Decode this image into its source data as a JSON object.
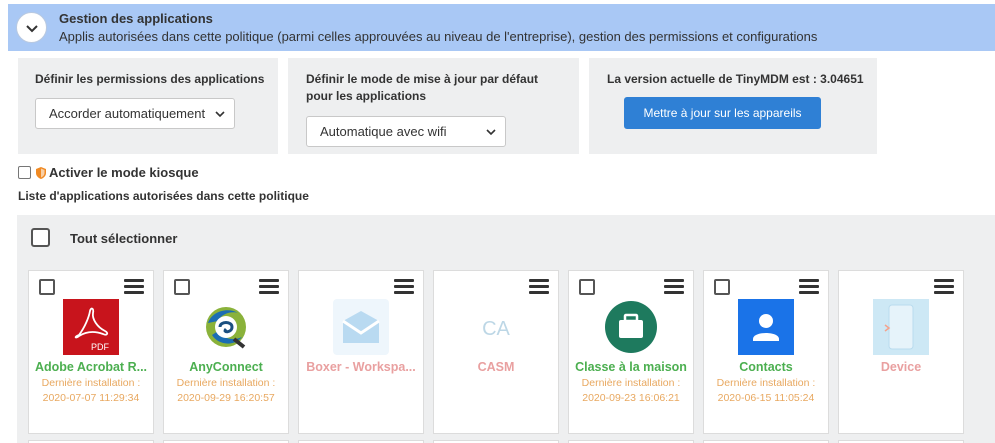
{
  "header": {
    "title": "Gestion des applications",
    "subtitle": "Applis autorisées dans cette politique (parmi celles approuvées au niveau de l'entreprise), gestion des permissions et configurations",
    "toggle_icon": "chevron-down-icon"
  },
  "permissions": {
    "label": "Définir les permissions des applications",
    "selected": "Accorder automatiquement"
  },
  "update_mode": {
    "label_line1": "Définir le mode de mise à jour par défaut",
    "label_line2": "pour les applications",
    "selected": "Automatique avec wifi"
  },
  "version": {
    "label": "La version actuelle de TinyMDM est : 3.04651",
    "button": "Mettre à jour sur les appareils"
  },
  "kiosk": {
    "label": "Activer le mode kiosque",
    "checked": false
  },
  "list_label": "Liste d'applications autorisées dans cette politique",
  "select_all": {
    "label": "Tout sélectionner"
  },
  "apps": [
    {
      "name": "Adobe Acrobat R...",
      "status": "enabled",
      "install_label": "Dernière installation :",
      "install_date": "2020-07-07 11:29:34",
      "icon": "adobe-acrobat-icon"
    },
    {
      "name": "AnyConnect",
      "status": "enabled",
      "install_label": "Dernière installation :",
      "install_date": "2020-09-29 16:20:57",
      "icon": "anyconnect-icon"
    },
    {
      "name": "Boxer - Workspa...",
      "status": "disabled",
      "install_label": "",
      "install_date": "",
      "icon": "boxer-envelope-icon"
    },
    {
      "name": "CASM",
      "status": "disabled",
      "install_label": "",
      "install_date": "",
      "icon": "casm-logo-icon"
    },
    {
      "name": "Classe à la maison",
      "status": "enabled",
      "install_label": "Dernière installation :",
      "install_date": "2020-09-23 16:06:21",
      "icon": "briefcase-icon"
    },
    {
      "name": "Contacts",
      "status": "enabled",
      "install_label": "Dernière installation :",
      "install_date": "2020-06-15 11:05:24",
      "icon": "contacts-icon"
    },
    {
      "name": "Device",
      "status": "disabled",
      "install_label": "",
      "install_date": "",
      "icon": "device-icon"
    }
  ],
  "colors": {
    "header_bg": "#a9c8f5",
    "panel_bg": "#eeeff0",
    "primary_button": "#2f80d5",
    "name_enabled": "#4caf50",
    "name_disabled": "#e9a0a0",
    "install_text": "#e8a860"
  }
}
